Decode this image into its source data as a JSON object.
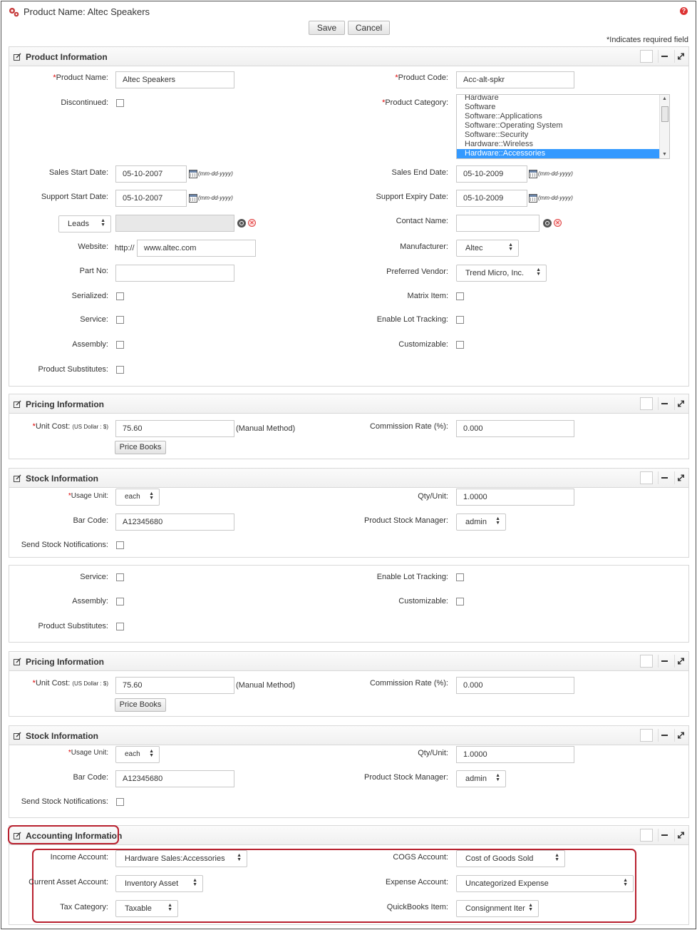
{
  "header": {
    "title": "Product Name: Altec Speakers",
    "save_label": "Save",
    "cancel_label": "Cancel",
    "required_note": "*Indicates required field"
  },
  "product_info": {
    "title": "Product Information",
    "product_name_label": "Product Name:",
    "product_name_value": "Altec Speakers",
    "product_code_label": "Product Code:",
    "product_code_value": "Acc-alt-spkr",
    "discontinued_label": "Discontinued:",
    "product_category_label": "Product Category:",
    "categories": [
      "Hardware",
      "Software",
      "Software::Applications",
      "Software::Operating System",
      "Software::Security",
      "Hardware::Wireless",
      "Hardware::Accessories"
    ],
    "selected_category": "Hardware::Accessories",
    "sales_start_label": "Sales Start Date:",
    "sales_start_value": "05-10-2007",
    "sales_end_label": "Sales End Date:",
    "sales_end_value": "05-10-2009",
    "support_start_label": "Support Start Date:",
    "support_start_value": "05-10-2007",
    "support_expiry_label": "Support Expiry Date:",
    "support_expiry_value": "05-10-2009",
    "date_format": "(mm-dd-yyyy)",
    "related_to_value": "Leads",
    "contact_name_label": "Contact Name:",
    "website_label": "Website:",
    "website_prefix": "http://",
    "website_value": "www.altec.com",
    "manufacturer_label": "Manufacturer:",
    "manufacturer_value": "Altec",
    "part_no_label": "Part No:",
    "preferred_vendor_label": "Preferred Vendor:",
    "preferred_vendor_value": "Trend Micro, Inc.",
    "serialized_label": "Serialized:",
    "matrix_item_label": "Matrix Item:",
    "service_label": "Service:",
    "lot_tracking_label": "Enable Lot Tracking:",
    "assembly_label": "Assembly:",
    "customizable_label": "Customizable:",
    "substitutes_label": "Product Substitutes:"
  },
  "pricing": {
    "title": "Pricing Information",
    "unit_cost_label": "Unit Cost:",
    "currency_note": "(US Dollar : $)",
    "unit_cost_value": "75.60",
    "manual_method": "(Manual Method)",
    "commission_label": "Commission Rate (%):",
    "commission_value": "0.000",
    "price_books_label": "Price Books"
  },
  "stock": {
    "title": "Stock Information",
    "usage_unit_label": "Usage Unit:",
    "usage_unit_value": "each",
    "qty_unit_label": "Qty/Unit:",
    "qty_unit_value": "1.0000",
    "bar_code_label": "Bar Code:",
    "bar_code_value": "A12345680",
    "stock_manager_label": "Product Stock Manager:",
    "stock_manager_value": "admin",
    "notifications_label": "Send Stock Notifications:"
  },
  "accounting": {
    "title": "Accounting Information",
    "income_label": "Income Account:",
    "income_value": "Hardware Sales:Accessories",
    "cogs_label": "COGS Account:",
    "cogs_value": "Cost of Goods Sold",
    "asset_label": "Current Asset Account:",
    "asset_value": "Inventory Asset",
    "expense_label": "Expense Account:",
    "expense_value": "Uncategorized Expense",
    "tax_label": "Tax Category:",
    "tax_value": "Taxable",
    "qb_item_label": "QuickBooks Item:",
    "qb_item_value": "Consignment Iter"
  },
  "colors": {
    "highlight": "#b8202e",
    "selection": "#3399ff",
    "required": "#dd0000"
  }
}
